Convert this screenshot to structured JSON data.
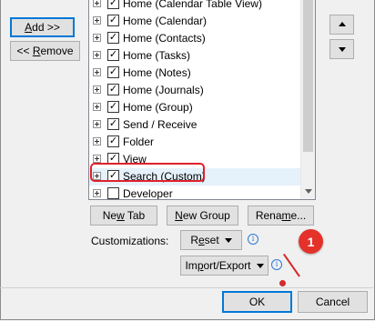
{
  "buttons": {
    "add": "Add >>",
    "remove": "<< Remove",
    "new_tab": "New Tab",
    "new_group": "New Group",
    "rename": "Rename...",
    "reset": "Reset",
    "import_export": "Import/Export",
    "ok": "OK",
    "cancel": "Cancel"
  },
  "customizations_label": "Customizations:",
  "tabs": [
    {
      "label": "Home (Calendar Table View)",
      "checked": true
    },
    {
      "label": "Home (Calendar)",
      "checked": true
    },
    {
      "label": "Home (Contacts)",
      "checked": true
    },
    {
      "label": "Home (Tasks)",
      "checked": true
    },
    {
      "label": "Home (Notes)",
      "checked": true
    },
    {
      "label": "Home (Journals)",
      "checked": true
    },
    {
      "label": "Home (Group)",
      "checked": true
    },
    {
      "label": "Send / Receive",
      "checked": true
    },
    {
      "label": "Folder",
      "checked": true
    },
    {
      "label": "View",
      "checked": true
    },
    {
      "label": "Search (Custom)",
      "checked": true
    },
    {
      "label": "Developer",
      "checked": false
    }
  ],
  "annotation": {
    "number": "1",
    "color": "#e4322b"
  },
  "colors": {
    "highlight": "#e0202c",
    "accent": "#0078d7",
    "info": "#2b79d6"
  },
  "icons": {
    "info": "info-circle-icon",
    "up": "triangle-up-icon",
    "down": "triangle-down-icon"
  }
}
